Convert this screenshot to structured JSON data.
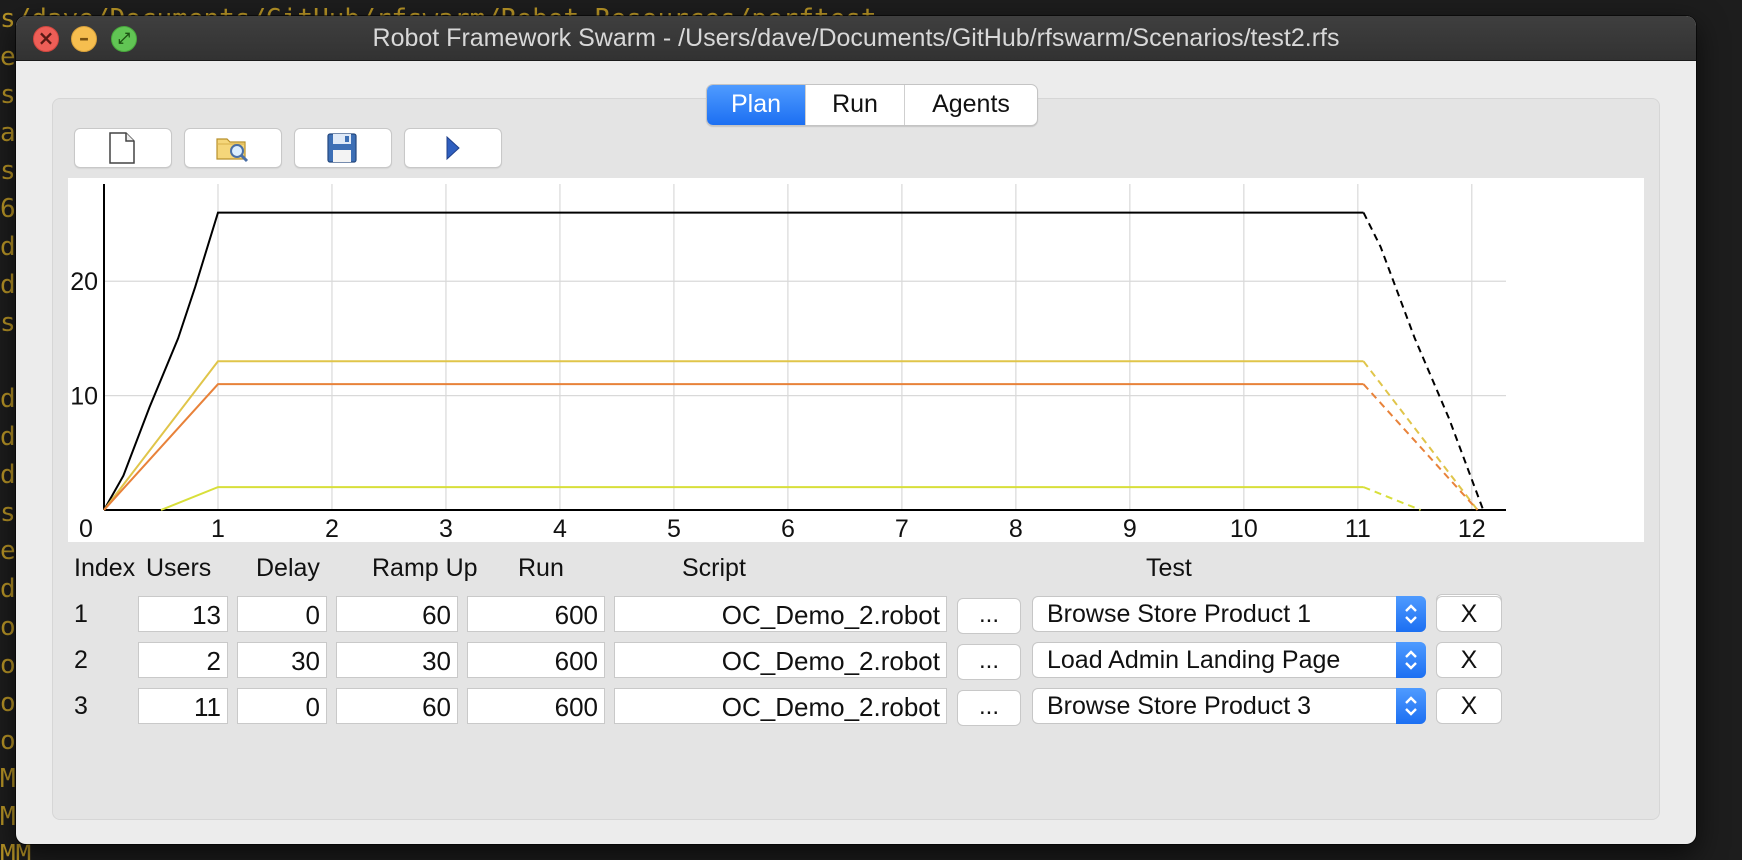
{
  "window": {
    "title": "Robot Framework Swarm - /Users/dave/Documents/GitHub/rfswarm/Scenarios/test2.rfs"
  },
  "tabs": [
    {
      "label": "Plan",
      "active": true
    },
    {
      "label": "Run",
      "active": false
    },
    {
      "label": "Agents",
      "active": false
    }
  ],
  "toolbar": {
    "buttons": [
      {
        "name": "new-file",
        "icon": "blank-page-icon"
      },
      {
        "name": "open-file",
        "icon": "folder-search-icon"
      },
      {
        "name": "save-file",
        "icon": "floppy-disk-icon"
      },
      {
        "name": "play",
        "icon": "play-triangle-icon"
      }
    ]
  },
  "chart_data": {
    "type": "line",
    "x_ticks": [
      "0",
      "1",
      "2",
      "3",
      "4",
      "5",
      "6",
      "7",
      "8",
      "9",
      "10",
      "11",
      "12"
    ],
    "y_ticks": [
      "10",
      "20"
    ],
    "xlim": [
      0,
      12.3
    ],
    "ylim": [
      0,
      28.5
    ],
    "grid": true,
    "series": [
      {
        "color": "#000000",
        "points": [
          [
            0,
            0
          ],
          [
            0.17,
            3
          ],
          [
            0.4,
            9
          ],
          [
            0.65,
            15
          ],
          [
            0.8,
            19.5
          ],
          [
            1,
            26
          ],
          [
            11.05,
            26
          ],
          [
            11.2,
            23
          ],
          [
            11.5,
            15
          ],
          [
            11.8,
            8
          ],
          [
            12.1,
            0
          ]
        ],
        "dashed_from": 11.05
      },
      {
        "color": "#e0c54a",
        "points": [
          [
            0,
            0
          ],
          [
            1,
            13
          ],
          [
            11.05,
            13
          ],
          [
            12.05,
            0
          ]
        ],
        "dashed_from": 11.05
      },
      {
        "color": "#e8823a",
        "points": [
          [
            0,
            0
          ],
          [
            1,
            11
          ],
          [
            11.05,
            11
          ],
          [
            12.05,
            0
          ]
        ],
        "dashed_from": 11.05
      },
      {
        "color": "#d8df3a",
        "points": [
          [
            0.5,
            0
          ],
          [
            1,
            2
          ],
          [
            11.05,
            2
          ],
          [
            11.55,
            0
          ]
        ],
        "dashed_from": 11.05
      }
    ]
  },
  "table": {
    "headers": {
      "index": "Index",
      "users": "Users",
      "delay": "Delay",
      "rampup": "Ramp Up",
      "run": "Run",
      "script": "Script",
      "test": "Test"
    },
    "add_label": "+",
    "browse_label": "...",
    "remove_label": "X",
    "rows": [
      {
        "index": "1",
        "users": "13",
        "delay": "0",
        "rampup": "60",
        "run": "600",
        "script": "OC_Demo_2.robot",
        "test": "Browse Store Product 1"
      },
      {
        "index": "2",
        "users": "2",
        "delay": "30",
        "rampup": "30",
        "run": "600",
        "script": "OC_Demo_2.robot",
        "test": "Load Admin Landing Page"
      },
      {
        "index": "3",
        "users": "11",
        "delay": "0",
        "rampup": "60",
        "run": "600",
        "script": "OC_Demo_2.robot",
        "test": "Browse Store Product 3"
      }
    ]
  },
  "colors": {
    "accent": "#1c6ff2",
    "background_code": "#c9a227"
  }
}
